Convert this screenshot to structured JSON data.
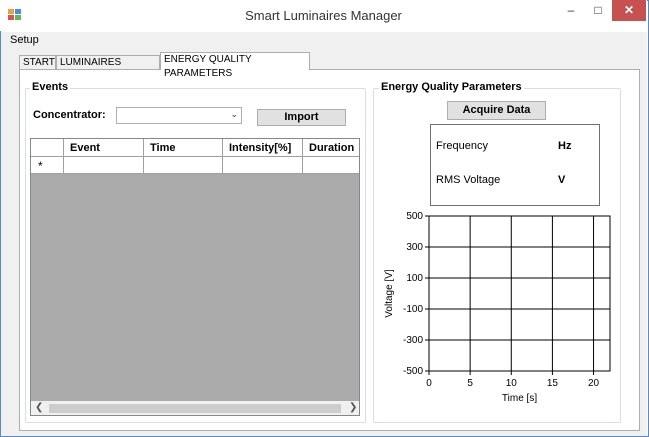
{
  "window": {
    "title": "Smart Luminaires Manager",
    "minimize_glyph": "–",
    "maximize_glyph": "□",
    "close_glyph": "✕",
    "icon": "app-grid-icon"
  },
  "menu": {
    "items": [
      "Setup"
    ]
  },
  "tabs": [
    {
      "label": "START",
      "selected": false
    },
    {
      "label": "LUMINAIRES CONTROL",
      "selected": false
    },
    {
      "label": "ENERGY QUALITY PARAMETERS",
      "selected": true
    }
  ],
  "events": {
    "group_title": "Events",
    "concentrator_label": "Concentrator:",
    "concentrator_value": "",
    "import_label": "Import",
    "grid": {
      "columns": [
        "Event",
        "Time",
        "Intensity[%]",
        "Duration"
      ],
      "new_row_glyph": "*",
      "rows": []
    }
  },
  "energy": {
    "group_title": "Energy Quality Parameters",
    "acquire_label": "Acquire Data",
    "frequency_label": "Frequency",
    "frequency_unit": "Hz",
    "rms_label": "RMS Voltage",
    "rms_unit": "V"
  },
  "chart_data": {
    "type": "line",
    "title": "",
    "xlabel": "Time [s]",
    "ylabel": "Voltage [V]",
    "xlim": [
      0,
      22
    ],
    "ylim": [
      -500,
      500
    ],
    "x_ticks": [
      0,
      5,
      10,
      15,
      20
    ],
    "y_ticks": [
      500,
      300,
      100,
      -100,
      -300,
      -500
    ],
    "grid": true,
    "series": []
  }
}
